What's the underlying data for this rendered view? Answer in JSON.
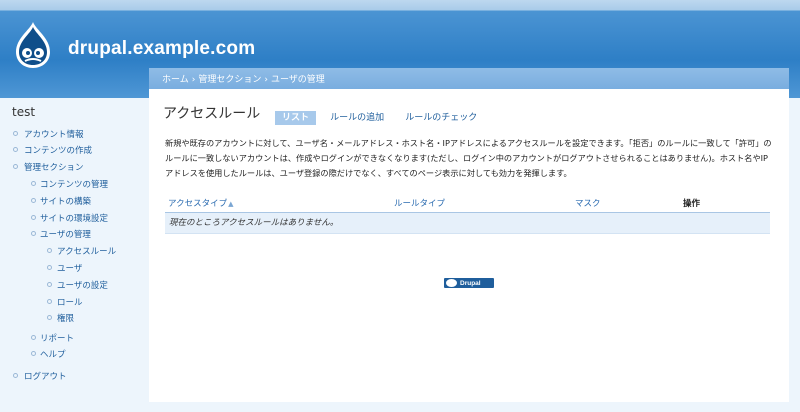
{
  "header": {
    "site_name": "drupal.example.com",
    "logo_icon": "drupal-drop-icon"
  },
  "breadcrumb": [
    "ホーム",
    "管理セクション",
    "ユーザの管理"
  ],
  "breadcrumb_separator": "›",
  "page": {
    "title": "アクセスルール",
    "tabs": [
      {
        "label": "リスト",
        "active": true
      },
      {
        "label": "ルールの追加",
        "active": false
      },
      {
        "label": "ルールのチェック",
        "active": false
      }
    ],
    "help_text": "新規や既存のアカウントに対して、ユーザ名・メールアドレス・ホスト名・IPアドレスによるアクセスルールを設定できます。「拒否」のルールに一致して「許可」のルールに一致しないアカウントは、作成やログインができなくなります(ただし、ログイン中のアカウントがログアウトさせられることはありません)。ホスト名やIPアドレスを使用したルールは、ユーザ登録の際だけでなく、すべてのページ表示に対しても効力を発揮します。"
  },
  "table": {
    "columns": [
      "アクセスタイプ",
      "ルールタイプ",
      "マスク",
      "操作"
    ],
    "sort_indicator": "▲",
    "empty_message": "現在のところアクセスルールはありません。"
  },
  "footer": {
    "powered_label": "Drupal"
  },
  "sidebar": {
    "user": "test",
    "items": [
      {
        "label": "アカウント情報",
        "level": 0
      },
      {
        "label": "コンテンツの作成",
        "level": 0
      },
      {
        "label": "管理セクション",
        "level": 0
      },
      {
        "label": "コンテンツの管理",
        "level": 1
      },
      {
        "label": "サイトの構築",
        "level": 1
      },
      {
        "label": "サイトの環境設定",
        "level": 1
      },
      {
        "label": "ユーザの管理",
        "level": 1
      },
      {
        "label": "アクセスルール",
        "level": 2
      },
      {
        "label": "ユーザ",
        "level": 2
      },
      {
        "label": "ユーザの設定",
        "level": 2
      },
      {
        "label": "ロール",
        "level": 2
      },
      {
        "label": "権限",
        "level": 2
      },
      {
        "label": "リポート",
        "level": 1
      },
      {
        "label": "ヘルプ",
        "level": 1
      },
      {
        "label": "ログアウト",
        "level": 0
      }
    ]
  },
  "colors": {
    "header_blue": "#2e7fc6",
    "link_blue": "#1f5e9c",
    "breadcrumb_bar": "#79addf",
    "active_tab": "#a7c9eb",
    "sidebar_bg": "#edf5fc"
  }
}
